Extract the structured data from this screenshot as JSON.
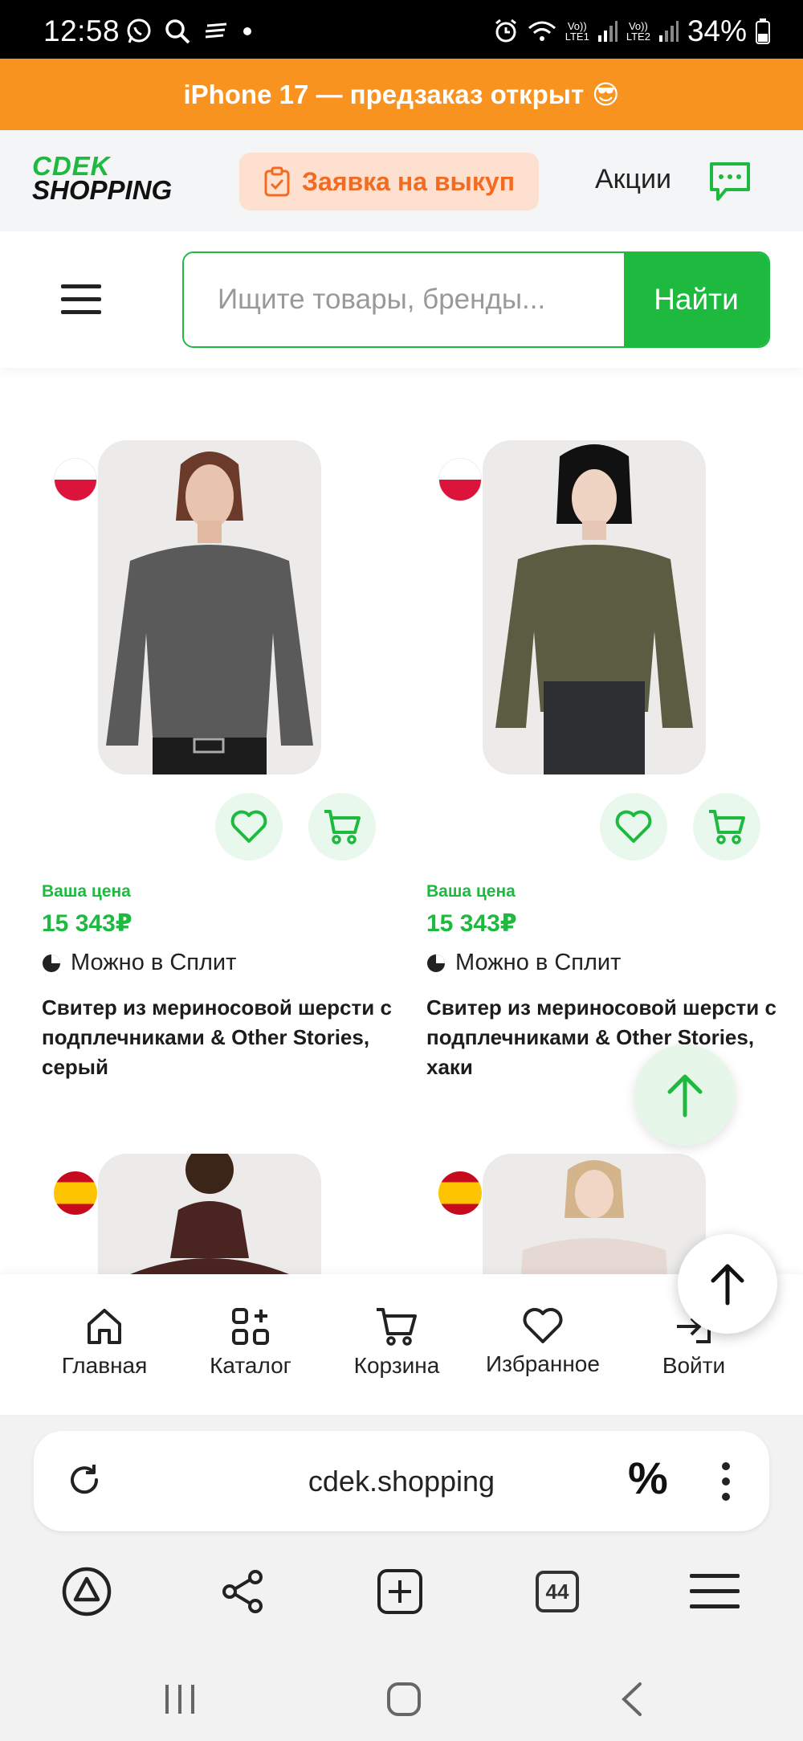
{
  "status_bar": {
    "time": "12:58",
    "battery": "34%",
    "sim1": "LTE1",
    "sim2": "LTE2",
    "volte": "Vo))"
  },
  "promo_banner": {
    "text": "iPhone 17 — предзаказ открыт",
    "emoji": "😎"
  },
  "header": {
    "logo_line1": "CDEK",
    "logo_line2": "SHOPPING",
    "buyout_button": "Заявка на выкуп",
    "promotions_link": "Акции"
  },
  "search": {
    "placeholder": "Ищите товары, бренды...",
    "button": "Найти"
  },
  "products": [
    {
      "price_label": "Ваша цена",
      "price": "15 343₽",
      "split": "Можно в Сплит",
      "title": "Свитер из мериносовой шерсти с подплечниками & Other Stories, серый",
      "flag": "poland",
      "sweater_color": "#5a5a5a"
    },
    {
      "price_label": "Ваша цена",
      "price": "15 343₽",
      "split": "Можно в Сплит",
      "title": "Свитер из мериносовой шерсти с подплечниками & Other Stories, хаки",
      "flag": "poland",
      "sweater_color": "#5b5d43"
    },
    {
      "flag": "spain",
      "sweater_color": "#4a2420"
    },
    {
      "flag": "spain",
      "sweater_color": "#e6d8d2"
    }
  ],
  "bottom_nav": {
    "home": "Главная",
    "catalog": "Каталог",
    "cart": "Корзина",
    "favorites": "Избранное",
    "login": "Войти"
  },
  "browser": {
    "url": "cdek.shopping",
    "tabs_count": "44"
  },
  "colors": {
    "brand_green": "#1dba3f",
    "promo_orange": "#f7931e",
    "buyout_orange": "#f26b21"
  }
}
